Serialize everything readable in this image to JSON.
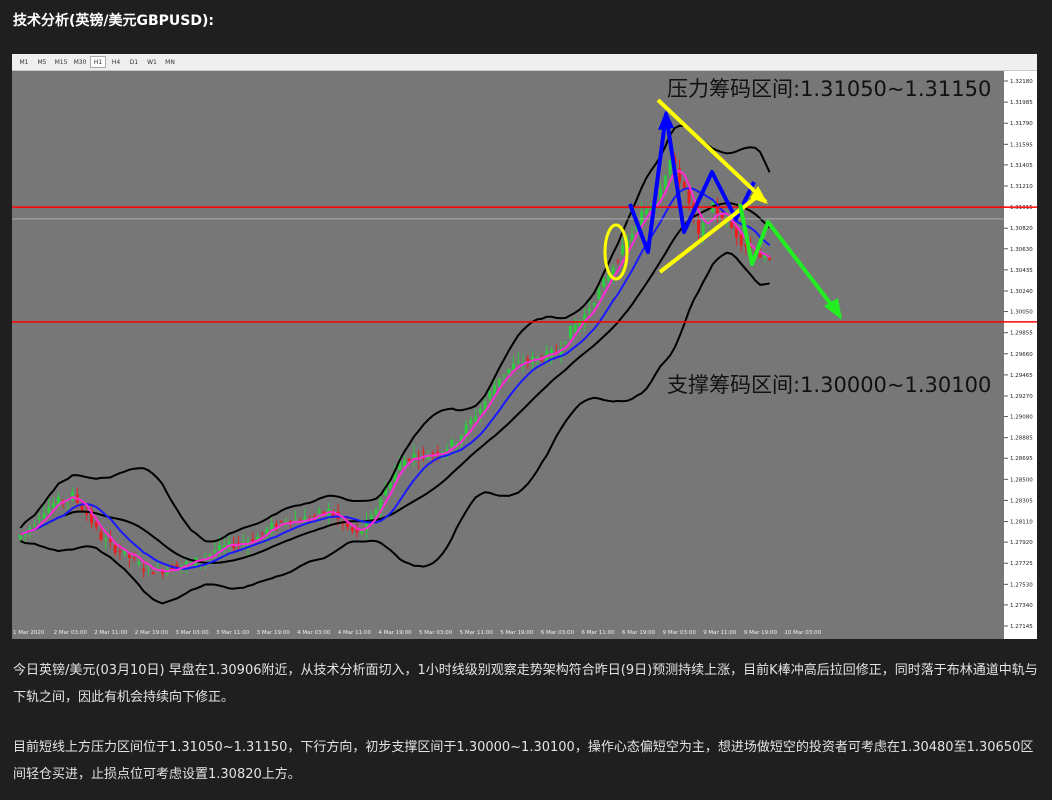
{
  "title": "技术分析(英镑/美元GBPUSD):",
  "timeframes": [
    "M1",
    "M5",
    "M15",
    "M30",
    "H1",
    "H4",
    "D1",
    "W1",
    "MN"
  ],
  "active_timeframe": "H1",
  "annotations": {
    "resistance": "压力筹码区间:1.31050~1.31150",
    "support": "支撑筹码区间:1.30000~1.30100"
  },
  "paragraphs": [
    "今日英镑/美元(03月10日) 早盘在1.30906附近，从技术分析面切入，1小时线级别观察走势架构符合昨日(9日)预测持续上涨，目前K棒冲高后拉回修正，同时落于布林通道中轨与下轨之间，因此有机会持续向下修正。",
    "目前短线上方压力区间位于1.31050~1.31150，下行方向，初步支撑区间于1.30000~1.30100，操作心态偏短空为主，想进场做短空的投资者可考虑在1.30480至1.30650区间轻仓买进，止损点位可考虑设置1.30820上方。"
  ],
  "colors": {
    "plot_bg": "#777777",
    "bull": "#2ecc40",
    "bear": "#e82020",
    "ma_fast": "#ff2bd6",
    "ma_slow": "#1a1aff",
    "bands": "#000000",
    "hline": "#ff0000",
    "arrow_blue": "#0000ff",
    "arrow_yellow": "#ffff00",
    "arrow_green": "#22ee22"
  },
  "chart_data": {
    "type": "candlestick",
    "symbol": "GBPUSD",
    "timeframe": "H1",
    "ylim": [
      1.27145,
      1.3218
    ],
    "y_ticks": [
      "1.32180",
      "1.31985",
      "1.31790",
      "1.31595",
      "1.31405",
      "1.31210",
      "1.31015",
      "1.30820",
      "1.30630",
      "1.30435",
      "1.30240",
      "1.30050",
      "1.29855",
      "1.29660",
      "1.29465",
      "1.29270",
      "1.29080",
      "1.28885",
      "1.28695",
      "1.28500",
      "1.28305",
      "1.28110",
      "1.27920",
      "1.27725",
      "1.27530",
      "1.27340",
      "1.27145"
    ],
    "x_ticks": [
      "1 Mar 2020",
      "2 Mar 03:00",
      "2 Mar 11:00",
      "2 Mar 19:00",
      "3 Mar 03:00",
      "3 Mar 11:00",
      "3 Mar 19:00",
      "4 Mar 03:00",
      "4 Mar 11:00",
      "4 Mar 19:00",
      "5 Mar 03:00",
      "5 Mar 11:00",
      "5 Mar 19:00",
      "6 Mar 03:00",
      "6 Mar 11:00",
      "6 Mar 19:00",
      "9 Mar 03:00",
      "9 Mar 11:00",
      "9 Mar 19:00",
      "10 Mar 03:00"
    ],
    "x_tick_labels_visible": [
      "1 Mar 2020",
      "2 Mar 03:00",
      "2 Mar 11:00",
      "2 Mar 19:00",
      "3 Mar 03:00",
      "3 Mar 11:00",
      "3 Mar 19:00",
      "4 Mar 03:00",
      "4 Mar 11:00",
      "4 Mar 19:00",
      "5 Mar 03:00",
      "5 Mar 11:00",
      "5 Mar 19:00",
      "6 Mar 03:00",
      "6 Mar 11:00",
      "6 Mar 19:00",
      "9 Mar 03:00",
      "9 Mar 11:00",
      "9 Mar 19:00",
      "10 Mar 03:00"
    ],
    "close_path": [
      1.2795,
      1.2806,
      1.2822,
      1.283,
      1.2835,
      1.2818,
      1.2796,
      1.2786,
      1.2778,
      1.2768,
      1.2765,
      1.277,
      1.2772,
      1.2776,
      1.2784,
      1.2789,
      1.2792,
      1.2797,
      1.2806,
      1.2813,
      1.2812,
      1.2816,
      1.2821,
      1.2808,
      1.2799,
      1.2814,
      1.2842,
      1.2866,
      1.2872,
      1.2873,
      1.2877,
      1.2886,
      1.2904,
      1.2922,
      1.2945,
      1.2955,
      1.296,
      1.2963,
      1.2968,
      1.2988,
      1.3002,
      1.3024,
      1.3048,
      1.307,
      1.3095,
      1.311,
      1.3145,
      1.3118,
      1.3075,
      1.3102,
      1.3088,
      1.307,
      1.306,
      1.305
    ],
    "horizontal_lines": [
      1.31015,
      1.29955
    ],
    "current_price": 1.30906
  }
}
